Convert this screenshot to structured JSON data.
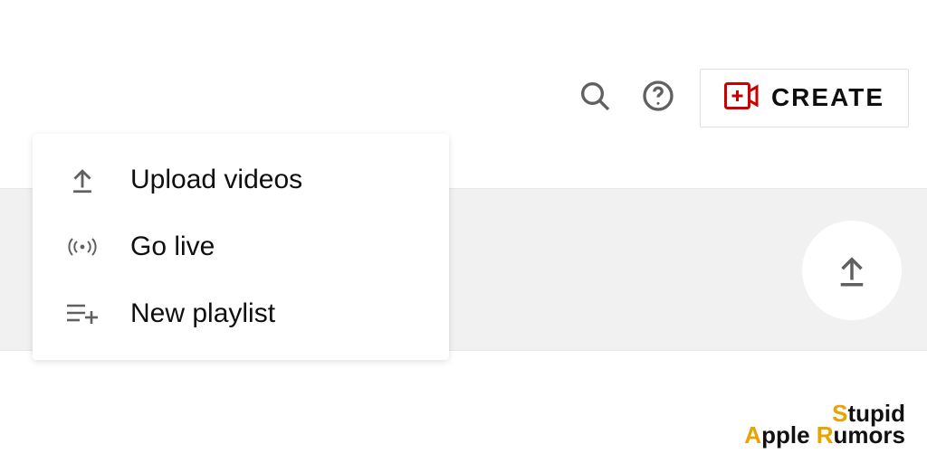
{
  "toolbar": {
    "create_label": "CREATE"
  },
  "menu": {
    "upload_videos": "Upload videos",
    "go_live": "Go live",
    "new_playlist": "New playlist"
  },
  "watermark": {
    "line1_gold": "S",
    "line1_rest": "tupid",
    "line2_a_gold": "A",
    "line2_a_rest": "pple ",
    "line2_r_gold": "R",
    "line2_r_rest": "umors"
  }
}
